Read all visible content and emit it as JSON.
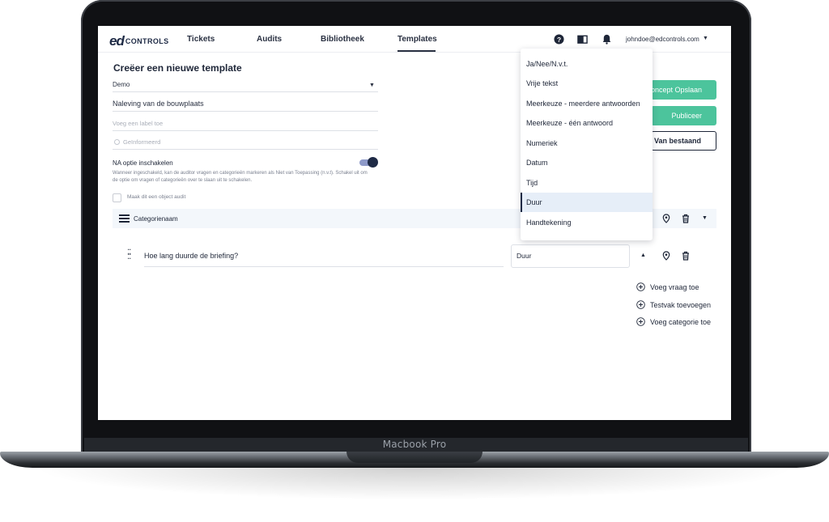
{
  "device_label": "Macbook Pro",
  "nav": {
    "logo_mark": "ed",
    "logo_text": "CONTROLS",
    "items": [
      "Tickets",
      "Audits",
      "Bibliotheek",
      "Templates"
    ],
    "active": "Templates",
    "user_email": "johndoe@edcontrols.com",
    "icons": [
      "help-circle-icon",
      "book-icon",
      "bell-icon"
    ]
  },
  "form": {
    "title": "Creëer een nieuwe template",
    "project_value": "Demo",
    "name_value": "Naleving van de bouwplaats",
    "label_placeholder": "Voeg een label toe",
    "informed_placeholder": "Geïnformeerd",
    "na_title": "NA optie inschakelen",
    "na_description": "Wanneer ingeschakeld, kan de auditor vragen en categorieën markeren als Niet van Toepassing (n.v.t). Schakel uit om de optie om vragen of categorieën over te slaan uit te schakelen.",
    "na_enabled": true,
    "object_audit_label": "Maak dit een object audit",
    "object_audit_checked": false
  },
  "category": {
    "name_placeholder": "Categorienaam"
  },
  "question": {
    "text": "Hoe lang duurde de briefing?",
    "type_value": "Duur"
  },
  "actions": {
    "add_question": "Voeg vraag toe",
    "add_test_field": "Testvak toevoegen",
    "add_category": "Voeg categorie toe"
  },
  "buttons": {
    "save_draft": "Concept Opslaan",
    "publish": "Publiceer",
    "from_file": "Van bestaand"
  },
  "dropdown": {
    "options": [
      "Ja/Nee/N.v.t.",
      "Vrije tekst",
      "Meerkeuze - meerdere antwoorden",
      "Meerkeuze - één antwoord",
      "Numeriek",
      "Datum",
      "Tijd",
      "Duur",
      "Handtekening"
    ],
    "selected": "Duur"
  },
  "colors": {
    "accent_green": "#4cc49c",
    "navy": "#1e2a45",
    "category_bar": "#f3f7fb"
  }
}
